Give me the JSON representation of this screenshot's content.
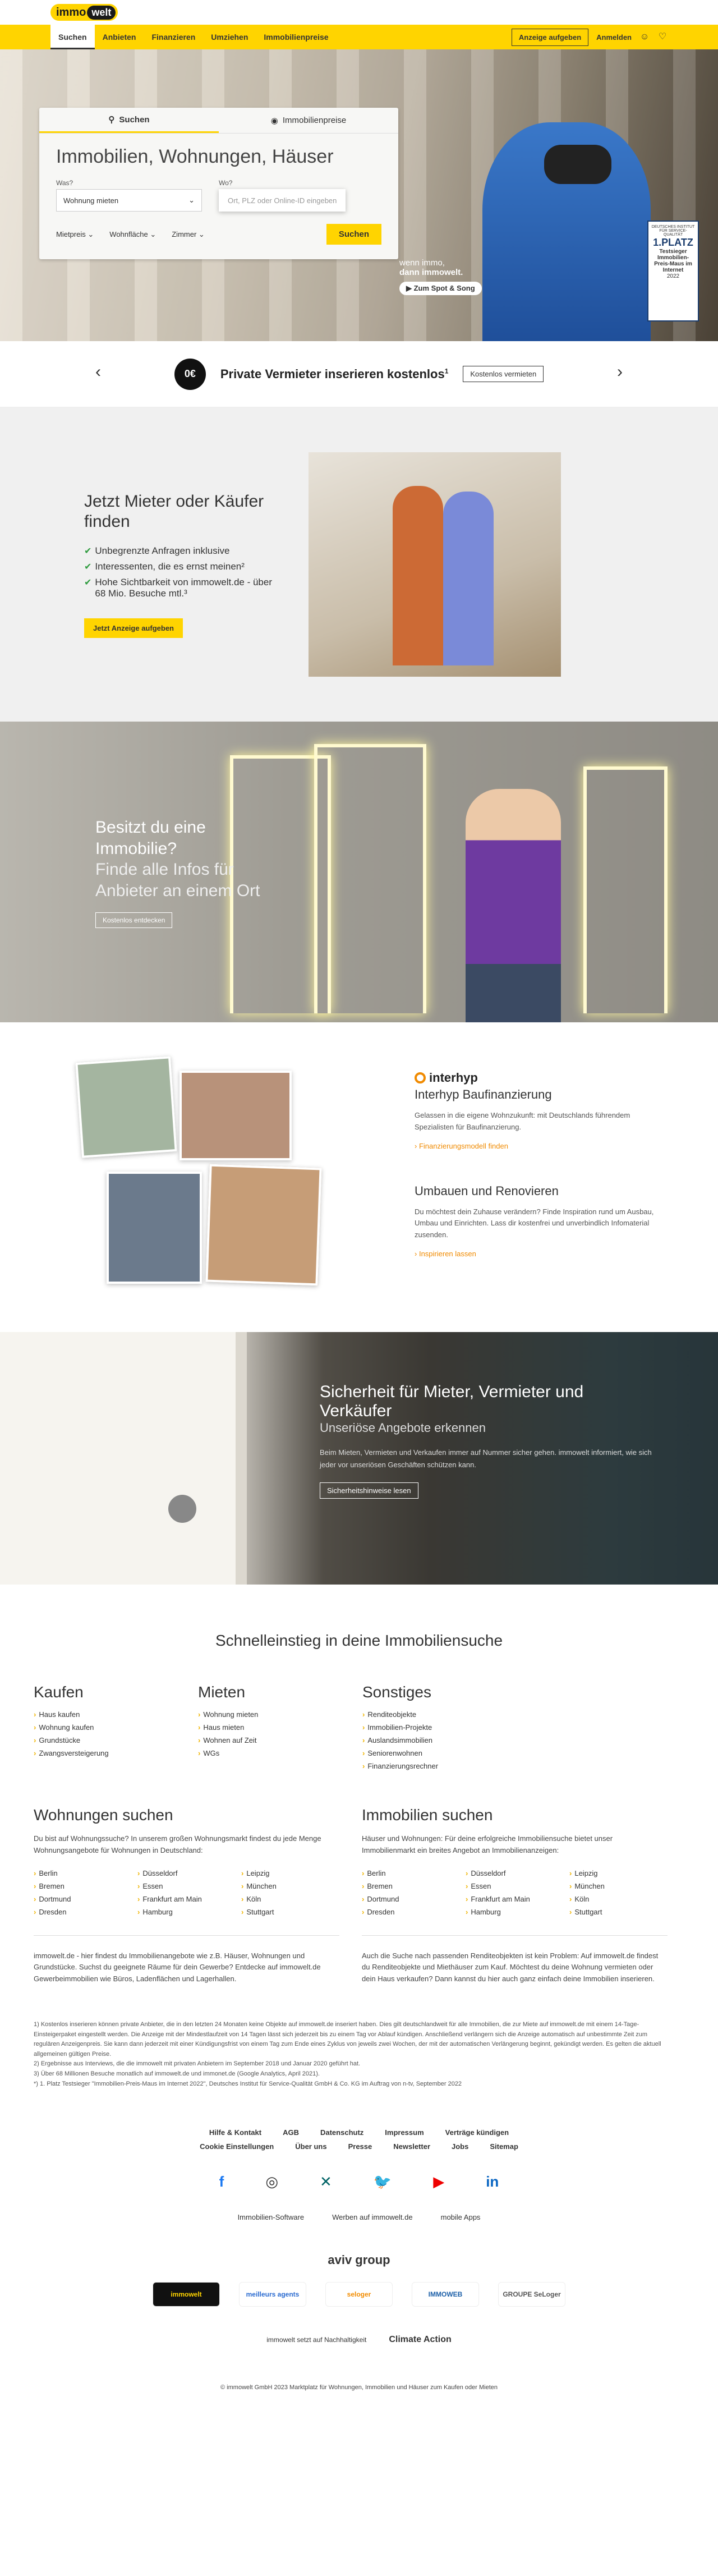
{
  "brand": {
    "logo_a": "immo",
    "logo_b": "welt"
  },
  "nav": {
    "items": [
      "Suchen",
      "Anbieten",
      "Finanzieren",
      "Umziehen",
      "Immobilienpreise"
    ],
    "cta": "Anzeige aufgeben",
    "login": "Anmelden"
  },
  "hero": {
    "tabs": [
      "Suchen",
      "Immobilienpreise"
    ],
    "title": "Immobilien, Wohnungen, Häuser",
    "was_label": "Was?",
    "was_value": "Wohnung mieten",
    "wo_label": "Wo?",
    "wo_placeholder": "Ort, PLZ oder Online-ID eingeben",
    "filters": [
      "Mietpreis",
      "Wohnfläche",
      "Zimmer"
    ],
    "search_button": "Suchen",
    "promo_line1": "wenn immo,",
    "promo_line2": "dann immowelt.",
    "promo_button": "Zum Spot & Song",
    "seal_top": "DEUTSCHES INSTITUT FÜR SERVICE-QUALITÄT",
    "seal_rank": "1.PLATZ",
    "seal_body": "Testsieger Immobilien-Preis-Maus im Internet",
    "seal_year": "2022"
  },
  "banner": {
    "badge": "0€",
    "text": "Private Vermieter inserieren kostenlos",
    "sup": "1",
    "button": "Kostenlos vermieten"
  },
  "mieter": {
    "title": "Jetzt Mieter oder Käufer finden",
    "bullets": [
      "Unbegrenzte Anfragen inklusive",
      "Interessenten, die es ernst meinen²",
      "Hohe Sichtbarkeit von immowelt.de - über 68 Mio. Besuche mtl.³"
    ],
    "button": "Jetzt Anzeige aufgeben"
  },
  "besitzt": {
    "title_line1": "Besitzt du eine",
    "title_line2": "Immobilie?",
    "sub_line1": "Finde alle Infos für",
    "sub_line2": "Anbieter an einem Ort",
    "button": "Kostenlos entdecken"
  },
  "interhyp": {
    "logo": "interhyp",
    "title": "Interhyp Baufinanzierung",
    "text": "Gelassen in die eigene Wohnzukunft: mit Deutschlands führendem Spezialisten für Baufinanzierung.",
    "link": "Finanzierungsmodell finden",
    "title2": "Umbauen und Renovieren",
    "text2": "Du möchtest dein Zuhause verändern? Finde Inspiration rund um Ausbau, Umbau und Einrichten. Lass dir kostenfrei und unverbindlich Infomaterial zusenden.",
    "link2": "Inspirieren lassen"
  },
  "sicherheit": {
    "title": "Sicherheit für Mieter, Vermieter und Verkäufer",
    "sub": "Unseriöse Angebote erkennen",
    "text": "Beim Mieten, Vermieten und Verkaufen immer auf Nummer sicher gehen. immowelt informiert, wie sich jeder vor unseriösen Geschäften schützen kann.",
    "button": "Sicherheitshinweise lesen"
  },
  "quick": {
    "title": "Schnelleinstieg in deine Immobiliensuche",
    "kaufen": {
      "title": "Kaufen",
      "items": [
        "Haus kaufen",
        "Wohnung kaufen",
        "Grundstücke",
        "Zwangsversteigerung"
      ]
    },
    "mieten": {
      "title": "Mieten",
      "items": [
        "Wohnung mieten",
        "Haus mieten",
        "Wohnen auf Zeit",
        "WGs"
      ]
    },
    "sonstiges": {
      "title": "Sonstiges",
      "items": [
        "Renditeobjekte",
        "Immobilien-Projekte",
        "Auslandsimmobilien",
        "Seniorenwohnen",
        "Finanzierungsrechner"
      ]
    }
  },
  "wohnungen": {
    "title": "Wohnungen suchen",
    "text": "Du bist auf Wohnungssuche? In unserem großen Wohnungsmarkt findest du jede Menge Wohnungsangebote für Wohnungen in Deutschland:",
    "cities": [
      "Berlin",
      "Düsseldorf",
      "Leipzig",
      "Bremen",
      "Essen",
      "München",
      "Dortmund",
      "Frankfurt am Main",
      "Köln",
      "Dresden",
      "Hamburg",
      "Stuttgart"
    ],
    "bottom": "immowelt.de - hier findest du Immobilienangebote wie z.B. Häuser, Wohnungen und Grundstücke. Suchst du geeignete Räume für dein Gewerbe? Entdecke auf immowelt.de Gewerbeimmobilien wie Büros, Ladenflächen und Lagerhallen."
  },
  "immobilien": {
    "title": "Immobilien suchen",
    "text": "Häuser und Wohnungen: Für deine erfolgreiche Immobiliensuche bietet unser Immobilienmarkt ein breites Angebot an Immobilienanzeigen:",
    "cities": [
      "Berlin",
      "Düsseldorf",
      "Leipzig",
      "Bremen",
      "Essen",
      "München",
      "Dortmund",
      "Frankfurt am Main",
      "Köln",
      "Dresden",
      "Hamburg",
      "Stuttgart"
    ],
    "bottom": "Auch die Suche nach passenden Renditeobjekten ist kein Problem: Auf immowelt.de findest du Renditeobjekte und Miethäuser zum Kauf. Möchtest du deine Wohnung vermieten oder dein Haus verkaufen? Dann kannst du hier auch ganz einfach deine Immobilien inserieren."
  },
  "footnotes": [
    "1) Kostenlos inserieren können private Anbieter, die in den letzten 24 Monaten keine Objekte auf immowelt.de inseriert haben. Dies gilt deutschlandweit für alle Immobilien, die zur Miete auf immowelt.de mit einem 14-Tage-Einsteigerpaket eingestellt werden. Die Anzeige mit der Mindestlaufzeit von 14 Tagen lässt sich jederzeit bis zu einem Tag vor Ablauf kündigen. Anschließend verlängern sich die Anzeige automatisch auf unbestimmte Zeit zum regulären Anzeigenpreis. Sie kann dann jederzeit mit einer Kündigungsfrist von einem Tag zum Ende eines Zyklus von jeweils zwei Wochen, der mit der automatischen Verlängerung beginnt, gekündigt werden. Es gelten die aktuell allgemeinen gültigen Preise.",
    "2) Ergebnisse aus Interviews, die die immowelt mit privaten Anbietern im September 2018 und Januar 2020 geführt hat.",
    "3) Über 68 Millionen Besuche monatlich auf immowelt.de und immonet.de (Google Analytics, April 2021).",
    "*) 1. Platz Testsieger \"Immobilien-Preis-Maus im Internet 2022\", Deutsches Institut für Service-Qualität GmbH & Co. KG im Auftrag von n-tv, September 2022"
  ],
  "footer": {
    "row1": [
      "Hilfe & Kontakt",
      "AGB",
      "Datenschutz",
      "Impressum",
      "Verträge kündigen"
    ],
    "row2": [
      "Cookie Einstellungen",
      "Über uns",
      "Presse",
      "Newsletter",
      "Jobs",
      "Sitemap"
    ],
    "social": [
      "f",
      "◎",
      "✕",
      "🐦",
      "▶",
      "in"
    ],
    "sublinks": [
      "Immobilien-Software",
      "Werben auf immowelt.de",
      "mobile Apps"
    ],
    "aviv": "aviv group",
    "brands": [
      "immowelt",
      "meilleurs agents",
      "seloger",
      "IMMOWEB",
      "GROUPE SeLoger"
    ],
    "climate_text": "immowelt setzt auf Nachhaltigkeit",
    "climate_logo": "Climate Action",
    "copyright": "© immowelt GmbH 2023 Marktplatz für Wohnungen, Immobilien und Häuser zum Kaufen oder Mieten"
  }
}
